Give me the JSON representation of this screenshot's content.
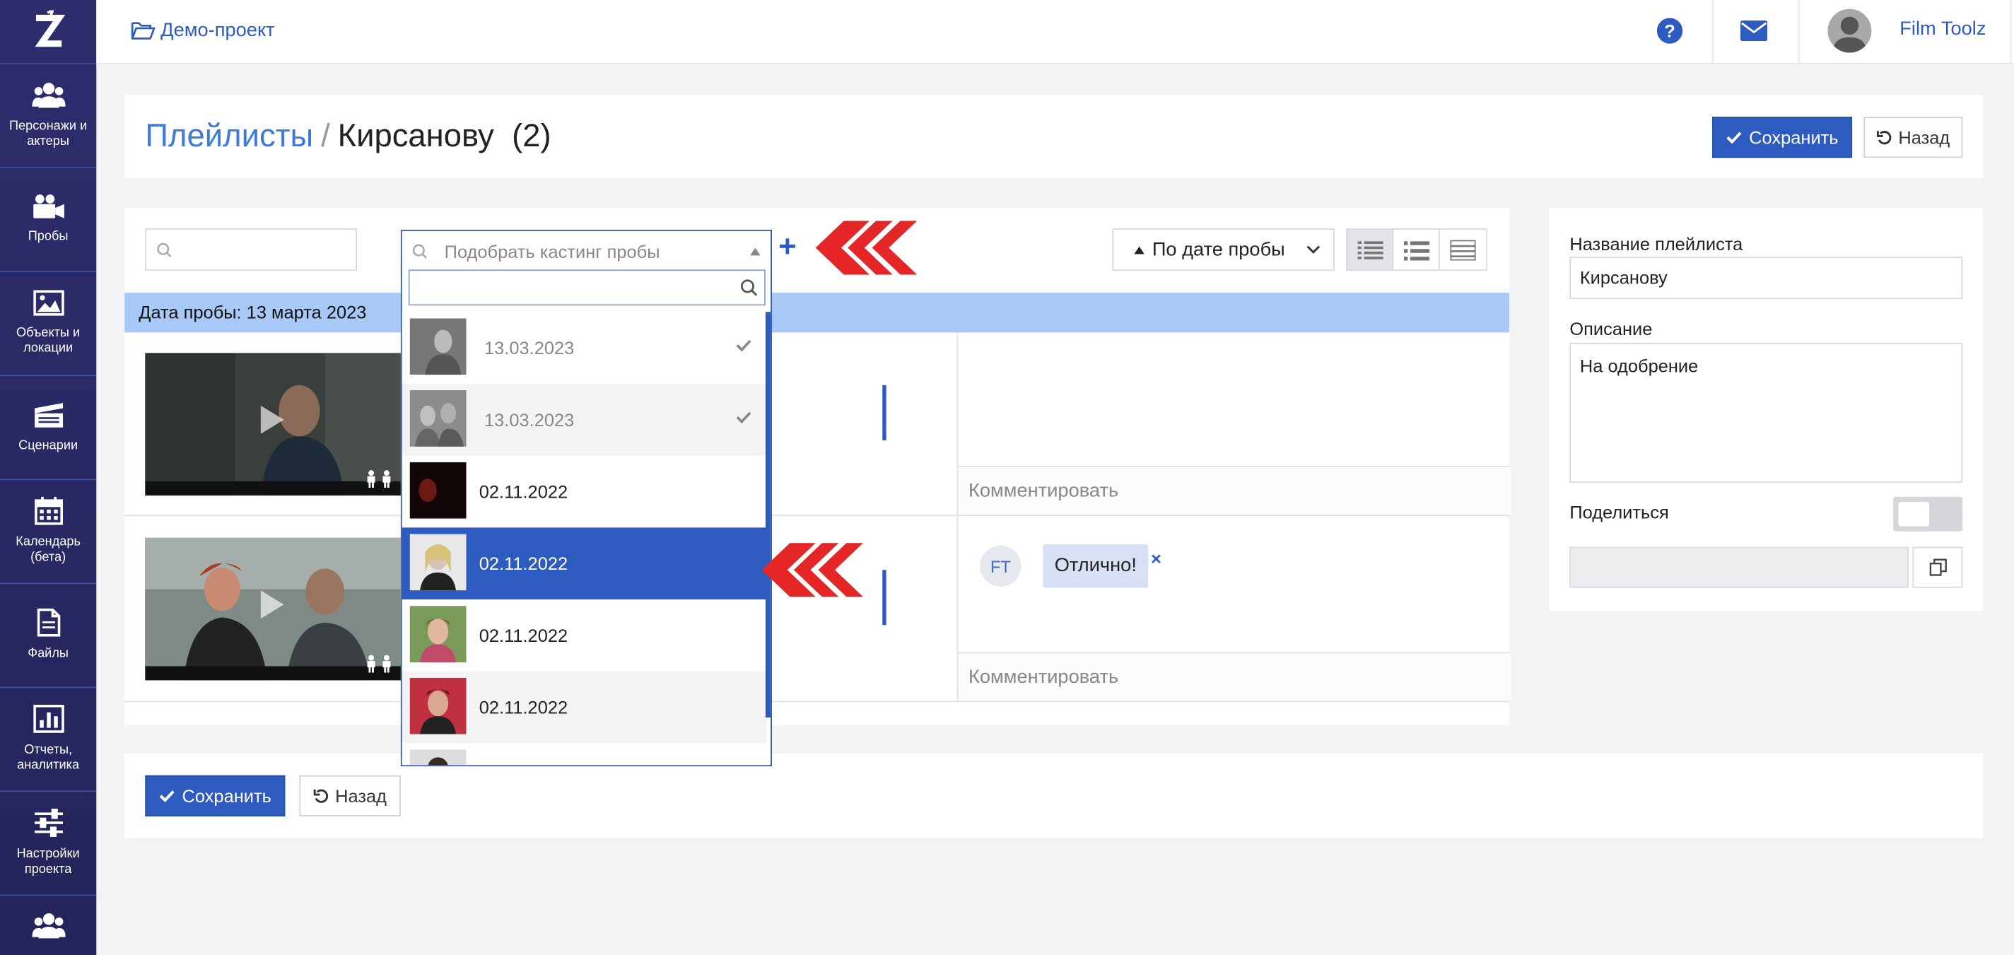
{
  "colors": {
    "sidebar": "#2d2d6e",
    "accent": "#2d5bbf",
    "date_bar": "#a8c8f5",
    "arrow": "#e42626"
  },
  "sidebar": {
    "items": [
      {
        "label": "Персонажи и актеры",
        "icon": "users-icon"
      },
      {
        "label": "Пробы",
        "icon": "video-camera-icon"
      },
      {
        "label": "Объекты и локации",
        "icon": "image-icon"
      },
      {
        "label": "Сценарии",
        "icon": "clapperboard-icon"
      },
      {
        "label": "Календарь (бета)",
        "icon": "calendar-icon"
      },
      {
        "label": "Файлы",
        "icon": "file-icon"
      },
      {
        "label": "Отчеты, аналитика",
        "icon": "bar-chart-icon"
      },
      {
        "label": "Настройки проекта",
        "icon": "sliders-icon"
      },
      {
        "label": "",
        "icon": "users-icon"
      }
    ]
  },
  "topbar": {
    "project": "Демо-проект",
    "user": "Film Toolz"
  },
  "header": {
    "breadcrumb_root": "Плейлисты",
    "separator": "/",
    "current": "Кирсанову  (2)",
    "save_label": "Сохранить",
    "back_label": "Назад"
  },
  "toolbar": {
    "search_placeholder": "",
    "casting_placeholder": "Подобрать кастинг пробы",
    "plus": "+",
    "sort_label": "По дате пробы"
  },
  "date_group": "Дата пробы: 13 марта 2023",
  "rows": [
    {
      "comment_placeholder": "Комментировать",
      "comments": []
    },
    {
      "comment_placeholder": "Комментировать",
      "comments": [
        {
          "author": "FT",
          "text": "Отлично!",
          "remove": "×"
        }
      ]
    }
  ],
  "dropdown": {
    "options": [
      {
        "date": "13.03.2023",
        "selected": true,
        "highlighted": false
      },
      {
        "date": "13.03.2023",
        "selected": true,
        "highlighted": false
      },
      {
        "date": "02.11.2022",
        "selected": false,
        "highlighted": false
      },
      {
        "date": "02.11.2022",
        "selected": false,
        "highlighted": true
      },
      {
        "date": "02.11.2022",
        "selected": false,
        "highlighted": false
      },
      {
        "date": "02.11.2022",
        "selected": false,
        "highlighted": false
      }
    ]
  },
  "right_panel": {
    "name_label": "Название плейлиста",
    "name_value": "Кирсанову",
    "desc_label": "Описание",
    "desc_value": "На одобрение",
    "share_label": "Поделиться",
    "share_link": ""
  },
  "footer": {
    "save_label": "Сохранить",
    "back_label": "Назад"
  }
}
